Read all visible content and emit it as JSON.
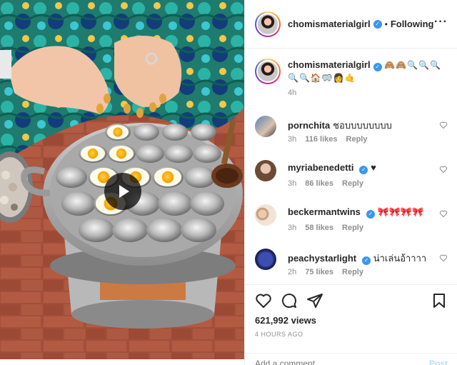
{
  "post": {
    "author": "chomismaterialgirl",
    "follow_separator": "•",
    "follow_status": "Following",
    "more_label": "···",
    "caption_emojis": "🙈🙈🔍🔍🔍🔍🔍🏠🥽👩🤙",
    "caption_time": "4h"
  },
  "comments": [
    {
      "user": "pornchita",
      "text": "ชอบบบบบบบบ",
      "verified": false,
      "time": "3h",
      "likes": "116 likes",
      "reply": "Reply"
    },
    {
      "user": "myriabenedetti",
      "text": "♥",
      "verified": true,
      "time": "3h",
      "likes": "86 likes",
      "reply": "Reply"
    },
    {
      "user": "beckermantwins",
      "text": "🎀🎀🎀🎀",
      "verified": true,
      "time": "3h",
      "likes": "58 likes",
      "reply": "Reply"
    },
    {
      "user": "peachystarlight",
      "text": "น่าเล่นอ้าาาา",
      "verified": true,
      "time": "2h",
      "likes": "75 likes",
      "reply": "Reply"
    }
  ],
  "stats": {
    "views": "621,992 views",
    "posted_ago": "4 HOURS AGO"
  },
  "composer": {
    "placeholder": "Add a comment…",
    "post_label": "Post"
  },
  "icons": {
    "play": "play-icon",
    "verified": "verified-badge-icon",
    "like": "heart-icon",
    "comment": "speech-bubble-icon",
    "share": "paper-plane-icon",
    "save": "bookmark-icon",
    "more": "ellipsis-icon"
  },
  "colors": {
    "verified": "#3897f0",
    "text": "#262626",
    "muted": "#8e8e8e",
    "border": "#efefef",
    "post_disabled": "#b2dffc"
  }
}
